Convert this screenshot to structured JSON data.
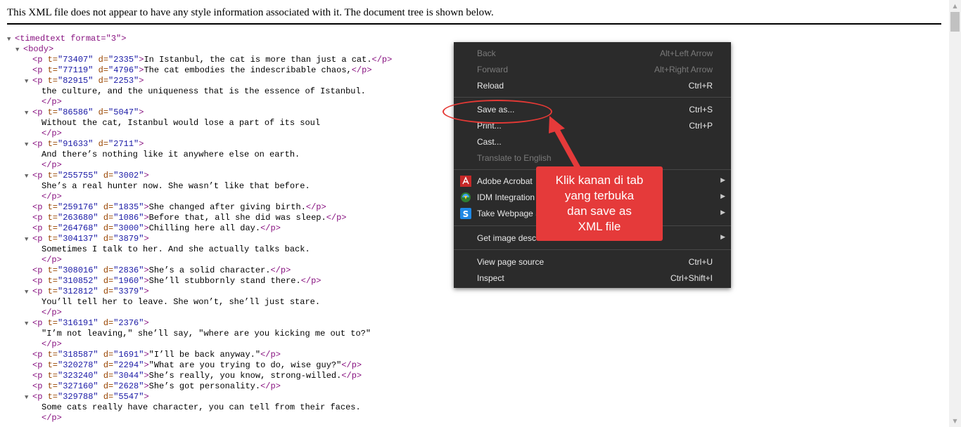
{
  "xml_viewer": {
    "notice": "This XML file does not appear to have any style information associated with it. The document tree is shown below.",
    "root_open": "<timedtext format=\"3\">",
    "body_open": "<body>",
    "paragraphs": [
      {
        "t": "73407",
        "d": "2335",
        "text": "In Istanbul, the cat is more than just a cat.",
        "collapsible": false
      },
      {
        "t": "77119",
        "d": "4796",
        "text": "The cat embodies the indescribable chaos,",
        "collapsible": false
      },
      {
        "t": "82915",
        "d": "2253",
        "text": "the culture, and the uniqueness that is the essence of Istanbul.",
        "collapsible": true
      },
      {
        "t": "86586",
        "d": "5047",
        "text": "Without the cat, Istanbul would lose a part of its soul",
        "collapsible": true
      },
      {
        "t": "91633",
        "d": "2711",
        "text": "And there’s nothing like it anywhere else on earth.",
        "collapsible": true
      },
      {
        "t": "255755",
        "d": "3002",
        "text": "She’s a real hunter now. She wasn’t like that before.",
        "collapsible": true
      },
      {
        "t": "259176",
        "d": "1835",
        "text": "She changed after giving birth.",
        "collapsible": false
      },
      {
        "t": "263680",
        "d": "1086",
        "text": "Before that, all she did was sleep.",
        "collapsible": false
      },
      {
        "t": "264768",
        "d": "3000",
        "text": "Chilling here all day.",
        "collapsible": false
      },
      {
        "t": "304137",
        "d": "3879",
        "text": "Sometimes I talk to her. And she actually talks back.",
        "collapsible": true
      },
      {
        "t": "308016",
        "d": "2836",
        "text": "She’s a solid character.",
        "collapsible": false
      },
      {
        "t": "310852",
        "d": "1960",
        "text": "She’ll stubbornly stand there.",
        "collapsible": false
      },
      {
        "t": "312812",
        "d": "3379",
        "text": "You’ll tell her to leave. She won’t, she’ll just stare.",
        "collapsible": true
      },
      {
        "t": "316191",
        "d": "2376",
        "text": "\"I’m not leaving,\" she’ll say, \"where are you kicking me out to?\"",
        "collapsible": true
      },
      {
        "t": "318587",
        "d": "1691",
        "text": "\"I’ll be back anyway.\"",
        "collapsible": false
      },
      {
        "t": "320278",
        "d": "2294",
        "text": "\"What are you trying to do, wise guy?\"",
        "collapsible": false
      },
      {
        "t": "323240",
        "d": "3044",
        "text": "She’s really, you know, strong-willed.",
        "collapsible": false
      },
      {
        "t": "327160",
        "d": "2628",
        "text": "She’s got personality.",
        "collapsible": false
      },
      {
        "t": "329788",
        "d": "5547",
        "text": "Some cats really have character, you can tell from their faces.",
        "collapsible": true
      }
    ]
  },
  "context_menu": {
    "items": [
      {
        "label": "Back",
        "shortcut": "Alt+Left Arrow",
        "disabled": true
      },
      {
        "label": "Forward",
        "shortcut": "Alt+Right Arrow",
        "disabled": true
      },
      {
        "label": "Reload",
        "shortcut": "Ctrl+R",
        "disabled": false
      },
      {
        "label": "Save as...",
        "shortcut": "Ctrl+S",
        "disabled": false
      },
      {
        "label": "Print...",
        "shortcut": "Ctrl+P",
        "disabled": false
      },
      {
        "label": "Cast...",
        "shortcut": "",
        "disabled": false
      },
      {
        "label": "Translate to English",
        "shortcut": "",
        "disabled": true
      },
      {
        "label": "Adobe Acrobat",
        "shortcut": "",
        "disabled": false,
        "submenu": true,
        "icon": "adobe-acrobat-icon"
      },
      {
        "label": "IDM Integration",
        "shortcut": "",
        "disabled": false,
        "submenu": true,
        "icon": "idm-icon"
      },
      {
        "label": "Take Webpage S",
        "shortcut": "",
        "disabled": false,
        "submenu": true,
        "icon": "screenshot-s-icon"
      },
      {
        "label": "Get image desc",
        "shortcut": "",
        "disabled": false,
        "submenu": true
      },
      {
        "label": "View page source",
        "shortcut": "Ctrl+U",
        "disabled": false
      },
      {
        "label": "Inspect",
        "shortcut": "Ctrl+Shift+I",
        "disabled": false
      }
    ]
  },
  "annotation": {
    "callout_text": "Klik kanan di tab\nyang terbuka\ndan save as\nXML file",
    "color": "#e53a3a"
  },
  "colors": {
    "tag": "#881280",
    "attr_name": "#994500",
    "attr_value": "#1a1aa6",
    "menu_bg": "#2b2b2b"
  }
}
